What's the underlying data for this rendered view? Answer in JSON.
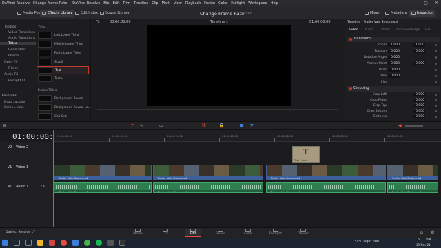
{
  "titlebar": {
    "app": "DaVinci Resolve - Change Frame Rate",
    "menu": [
      "DaVinci Resolve",
      "File",
      "Edit",
      "Trim",
      "Timeline",
      "Clip",
      "Mark",
      "View",
      "Playback",
      "Fusion",
      "Color",
      "Fairlight",
      "Workspace",
      "Help"
    ]
  },
  "toolbar": {
    "media_pool": "Media Pool",
    "effects_library": "Effects Library",
    "edit_index": "Edit Index",
    "sound_library": "Sound Library",
    "project_title": "Change Frame Rate",
    "project_status": "Edited",
    "mixer": "Mixer",
    "metadata": "Metadata",
    "inspector": "Inspector"
  },
  "effects_tree": {
    "items": [
      "Toolbox",
      "Video Transitions",
      "Audio Transitions",
      "Titles",
      "Generators",
      "Effects",
      "Open FX",
      "Filters",
      "Audio FX",
      "Fairlight FX"
    ],
    "favorites_label": "Favorites",
    "favorites": [
      "Drop...ackive",
      "Camo...hake"
    ]
  },
  "titles_panel": {
    "header": "Titles",
    "items": [
      "Left Lower Third",
      "Middle Lower Third",
      "Right Lower Third",
      "Scroll",
      "Text",
      "Text+"
    ],
    "fusion_header": "Fusion Titles",
    "fusion_items": [
      "Background Reveal",
      "Background Reveal Lo...",
      "Call Out"
    ]
  },
  "viewer": {
    "zoom": "Fit",
    "tc_left": "00:00:00:00",
    "timeline_name": "Timeline 1",
    "tc_right": "01:00:00:00"
  },
  "inspector": {
    "clip_title": "Timeline - Trailer Valo Shots.mp4",
    "tabs": [
      "Video",
      "Audio",
      "Effects",
      "Transition",
      "Image",
      "File"
    ],
    "transform_label": "Transform",
    "params": [
      {
        "label": "Zoom",
        "x": "1.000",
        "y": "1.000"
      },
      {
        "label": "Position",
        "x": "0.000",
        "y": "0.000"
      },
      {
        "label": "Rotation Angle",
        "x": "0.000",
        "y": ""
      },
      {
        "label": "Anchor Point",
        "x": "0.000",
        "y": "0.000"
      },
      {
        "label": "Pitch",
        "x": "0.000",
        "y": ""
      },
      {
        "label": "Yaw",
        "x": "0.000",
        "y": ""
      },
      {
        "label": "Flip",
        "x": "",
        "y": ""
      }
    ],
    "cropping_label": "Cropping",
    "crop": [
      {
        "label": "Crop Left",
        "v": "0.000"
      },
      {
        "label": "Crop Right",
        "v": "0.000"
      },
      {
        "label": "Crop Top",
        "v": "0.000"
      },
      {
        "label": "Crop Bottom",
        "v": "0.000"
      },
      {
        "label": "Softness",
        "v": "0.000"
      }
    ]
  },
  "timeline": {
    "timecode": "01:00:00:00",
    "ruler": [
      "01:00:00:00",
      "01:00:05:00",
      "01:00:10:00",
      "01:00:15:00",
      "01:00:20:00",
      "01:00:25:00",
      "01:00:30:00",
      "01:00:35:00"
    ],
    "tracks": {
      "v2": "V2",
      "v2_name": "Video 2",
      "v1": "V1",
      "v1_name": "Video 1",
      "a1": "A1",
      "a1_name": "Audio 1",
      "a1_ch": "2.0"
    },
    "title_clip_label": "Text - Basic",
    "clip_name": "Trailer Valo Shots.mp4"
  },
  "pages": [
    "Media",
    "Cut",
    "Edit",
    "Fusion",
    "Color",
    "Fairlight",
    "Deliver"
  ],
  "footer": {
    "app_name": "DaVinci Resolve 17"
  },
  "taskbar": {
    "weather": "37°C  Light rain",
    "time": "5:11 PM",
    "date": "19-Nov-21"
  },
  "colors": {
    "accent": "#e74c3c",
    "video_clip": "#3a5f9c",
    "audio_clip": "#2e7d4f"
  }
}
